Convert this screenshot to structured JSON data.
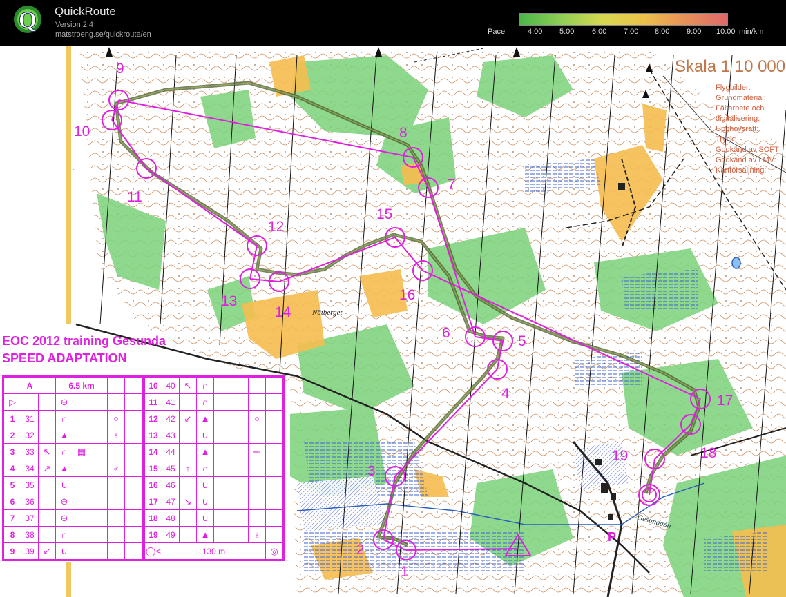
{
  "app": {
    "title": "QuickRoute",
    "version": "Version 2.4",
    "url": "matstroeng.se/quickroute/en"
  },
  "pace": {
    "label": "Pace",
    "ticks": [
      "4:00",
      "5:00",
      "6:00",
      "7:00",
      "8:00",
      "9:00",
      "10:00"
    ],
    "unit": "min/km",
    "gradient_colors": [
      "#4ab64a",
      "#8fcf55",
      "#d8d850",
      "#ecc04a",
      "#e8905a",
      "#e06868"
    ]
  },
  "map": {
    "scale_title": "Skala 1 10 000",
    "credit_lines": [
      "Flygbilder:",
      "Grundmaterial:",
      "Fältarbete och",
      "digitalisering:",
      "Upphovsrätt:",
      "Tryck:",
      "Godkänd av SOFT",
      "Godkänd av LMV:",
      "Kartförsäljning:"
    ],
    "place_name": "Nätberget",
    "stream_name": "Gesundaån",
    "parking_symbol": "P",
    "event_title": "EOC 2012 training Gesunda",
    "event_subtitle": "SPEED ADAPTATION",
    "colors": {
      "course": "#e020e0",
      "route": "#5a6a2a",
      "forest_green": "#7bd27b",
      "open_yellow": "#f5bd4f",
      "contour": "#b4652a"
    },
    "controls": [
      "1",
      "2",
      "3",
      "4",
      "5",
      "6",
      "7",
      "8",
      "9",
      "10",
      "11",
      "12",
      "13",
      "14",
      "15",
      "16",
      "17",
      "18",
      "19"
    ]
  },
  "description_left": {
    "class_name": "A",
    "length": "6.5 km",
    "rows": [
      [
        "1",
        "31",
        "",
        "∩",
        "",
        "",
        "○",
        ""
      ],
      [
        "2",
        "32",
        "",
        "▲",
        "",
        "",
        "♁",
        ""
      ],
      [
        "3",
        "33",
        "↖",
        "∩",
        "▦",
        "",
        "",
        ""
      ],
      [
        "4",
        "34",
        "↗",
        "▲",
        "",
        "",
        "♂",
        ""
      ],
      [
        "5",
        "35",
        "",
        "∪",
        "",
        "",
        "",
        ""
      ],
      [
        "6",
        "36",
        "",
        "⊖",
        "",
        "",
        "",
        ""
      ],
      [
        "7",
        "37",
        "",
        "⊖",
        "",
        "",
        "",
        ""
      ],
      [
        "8",
        "38",
        "",
        "∩",
        "",
        "",
        "",
        ""
      ],
      [
        "9",
        "39",
        "↙",
        "∪",
        "",
        "",
        "",
        ""
      ]
    ]
  },
  "description_right": {
    "rows": [
      [
        "10",
        "40",
        "↖",
        "∩",
        "",
        "",
        "",
        ""
      ],
      [
        "11",
        "41",
        "",
        "∩",
        "",
        "",
        "",
        ""
      ],
      [
        "12",
        "42",
        "↙",
        "▲",
        "",
        "",
        "○",
        ""
      ],
      [
        "13",
        "43",
        "",
        "∪",
        "",
        "",
        "",
        ""
      ],
      [
        "14",
        "44",
        "",
        "▲",
        "",
        "",
        "⊸",
        ""
      ],
      [
        "15",
        "45",
        "↑",
        "∩",
        "",
        "",
        "",
        ""
      ],
      [
        "16",
        "46",
        "",
        "∪",
        "",
        "",
        "",
        ""
      ],
      [
        "17",
        "47",
        "↘",
        "∪",
        "",
        "",
        "",
        ""
      ],
      [
        "18",
        "48",
        "",
        "∪",
        "",
        "",
        "",
        ""
      ],
      [
        "19",
        "49",
        "",
        "▲",
        "",
        "",
        "♁",
        ""
      ]
    ],
    "finish_distance": "130 m"
  }
}
